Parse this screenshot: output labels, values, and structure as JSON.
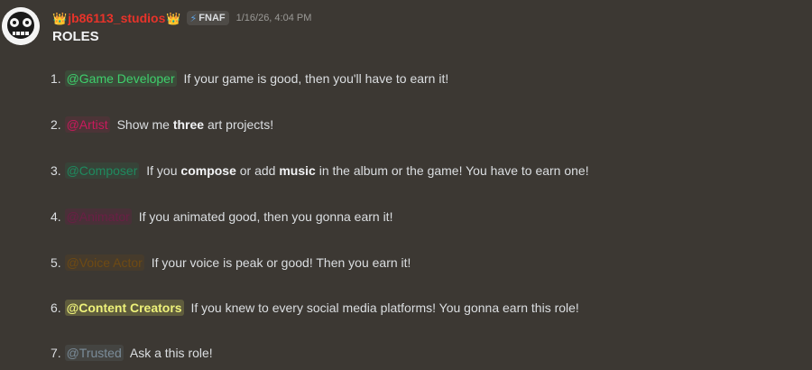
{
  "message": {
    "crown_icon": "crown-emoji",
    "username": "jb86113_studios",
    "tag": {
      "icon": "lightning-bolt-icon",
      "label": "FNAF"
    },
    "timestamp": "1/16/26, 4:04 PM",
    "title": "ROLES"
  },
  "roles": [
    {
      "num": "1.",
      "mention": "@Game Developer",
      "color": "#3ecf6c",
      "text_a": "If your game is good, then you'll have to earn it!"
    },
    {
      "num": "2.",
      "mention": "@Artist",
      "color": "#c91a5c",
      "text_a": "Show me ",
      "bold_1": "three",
      "text_b": " art projects!"
    },
    {
      "num": "3.",
      "mention": "@Composer",
      "color": "#1f8a5f",
      "text_a": "If you ",
      "bold_1": "compose",
      "text_b": " or add ",
      "bold_2": "music",
      "text_c": " in the album or the game! You have to earn one!"
    },
    {
      "num": "4.",
      "mention": "@Animator",
      "color": "#6a1f45",
      "text_a": "If you animated good, then you gonna earn it!"
    },
    {
      "num": "5.",
      "mention": "@Voice Actor",
      "color": "#6e4a14",
      "text_a": "If your voice is peak or good! Then you earn it!"
    },
    {
      "num": "6.",
      "mention": "@Content Creators",
      "color": "#eef27a",
      "text_a": "If you knew to every social media platforms! You gonna earn this role!"
    },
    {
      "num": "7.",
      "mention": "@Trusted",
      "color": "#7b8c99",
      "text_a": "Ask a this role!"
    }
  ]
}
